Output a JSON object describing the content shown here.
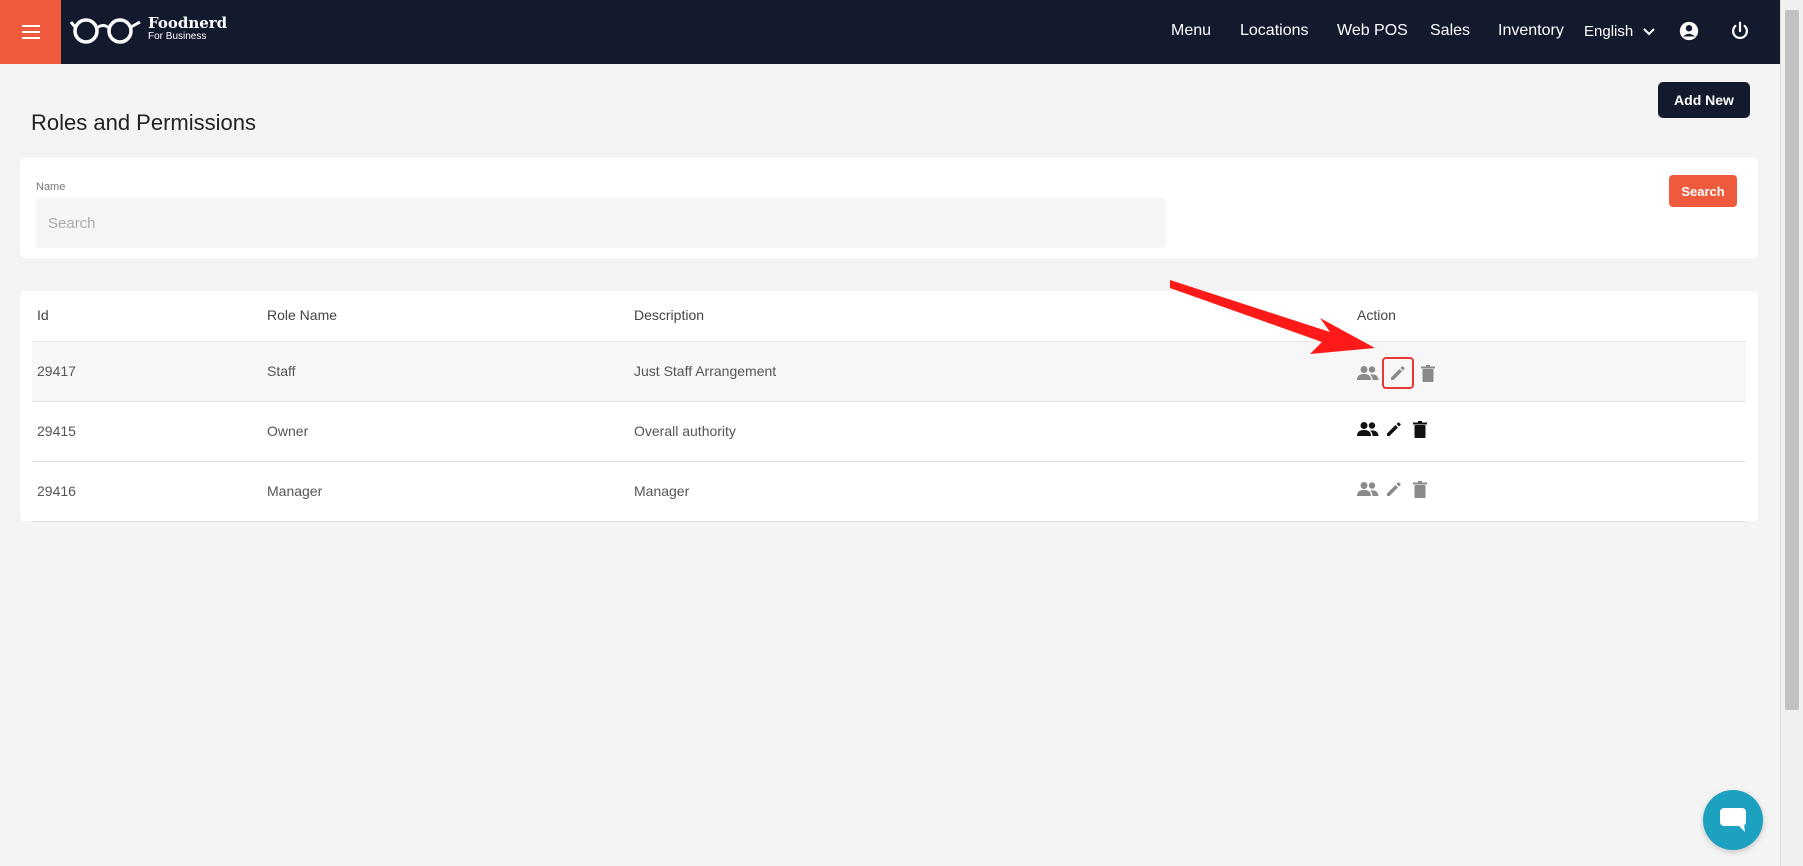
{
  "brand": {
    "name": "Foodnerd",
    "tagline": "For Business",
    "accent": "#f05a3c",
    "navbar_bg": "#141a2e"
  },
  "nav": {
    "links": [
      "Menu",
      "Locations",
      "Web POS",
      "Sales",
      "Inventory"
    ],
    "language": "English",
    "icons": [
      "account-circle-icon",
      "power-icon"
    ]
  },
  "page": {
    "title": "Roles and Permissions",
    "add_new_label": "Add New"
  },
  "search": {
    "label": "Name",
    "placeholder": "Search",
    "value": "",
    "button_label": "Search"
  },
  "table": {
    "headers": [
      "Id",
      "Role Name",
      "Description",
      "Action"
    ],
    "rows": [
      {
        "id": "29417",
        "role_name": "Staff",
        "description": "Just Staff Arrangement"
      },
      {
        "id": "29415",
        "role_name": "Owner",
        "description": "Overall authority"
      },
      {
        "id": "29416",
        "role_name": "Manager",
        "description": "Manager"
      }
    ],
    "action_icons": [
      "people-icon",
      "pencil-edit-icon",
      "trash-icon"
    ]
  },
  "annotation": {
    "color": "#e53935",
    "target": "edit icon of role Staff"
  }
}
